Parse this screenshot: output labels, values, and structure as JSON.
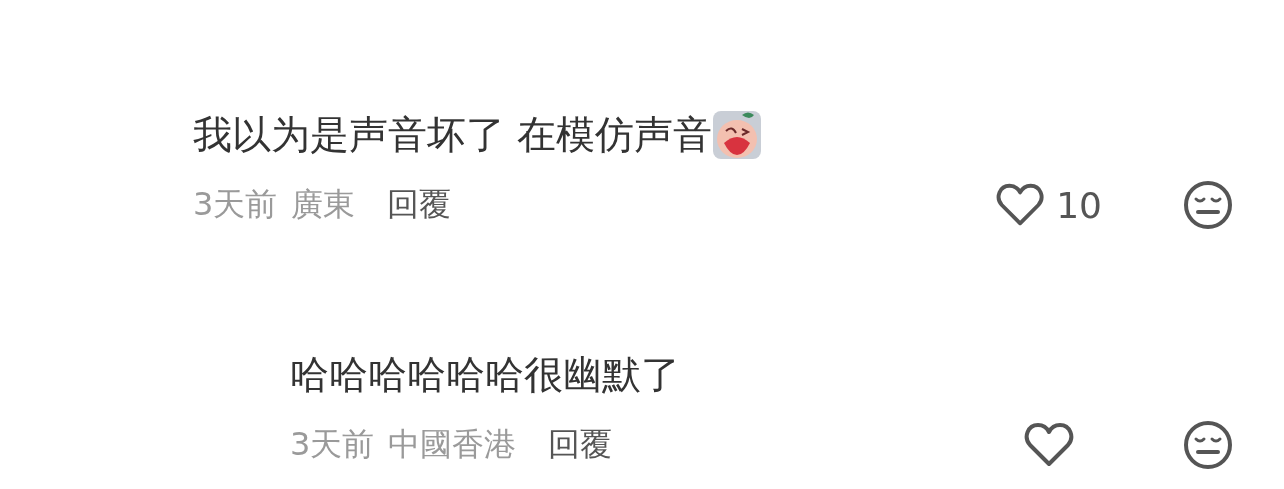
{
  "comments": [
    {
      "text": "我以为是声音坏了 在模仿声音",
      "sticker": true,
      "time": "3天前",
      "location": "廣東",
      "reply": "回覆",
      "likes": "10",
      "replies": [
        {
          "text": "哈哈哈哈哈哈很幽默了",
          "sticker": false,
          "time": "3天前",
          "location": "中國香港",
          "reply": "回覆"
        }
      ]
    }
  ]
}
